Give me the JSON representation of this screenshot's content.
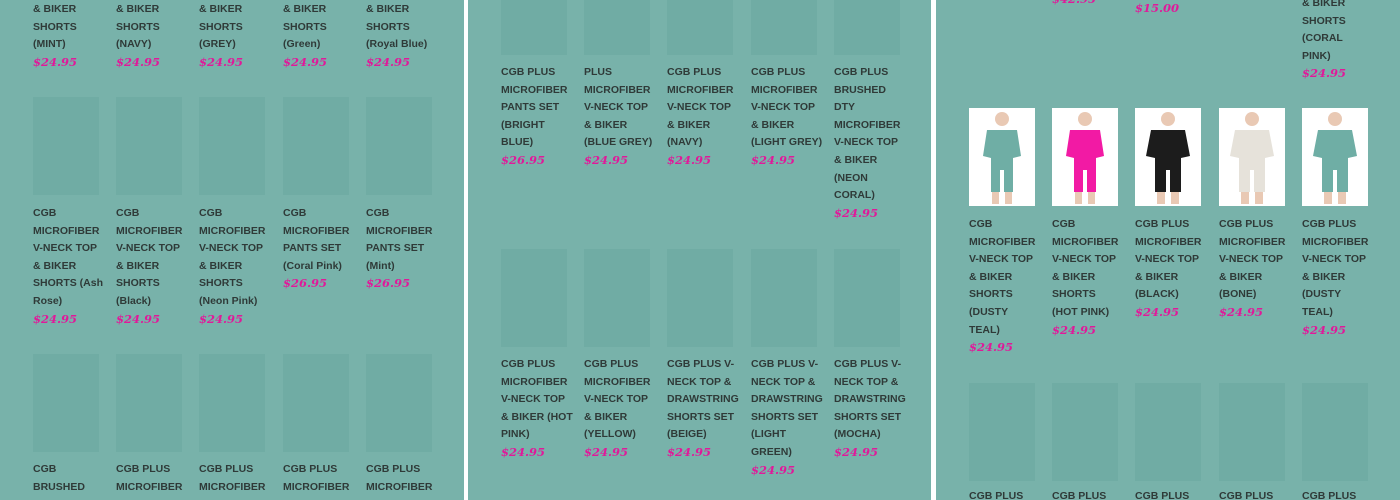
{
  "colors": {
    "background": "#78b2aa",
    "price": "#e0199a",
    "text": "#2f3a38",
    "placeholder": "#70aca4"
  },
  "panels": [
    {
      "rows": [
        [
          {
            "name": "& BIKER SHORTS (MINT)",
            "price": "$24.95"
          },
          {
            "name": "& BIKER SHORTS (NAVY)",
            "price": "$24.95"
          },
          {
            "name": "& BIKER SHORTS (GREY)",
            "price": "$24.95"
          },
          {
            "name": "& BIKER SHORTS (Green)",
            "price": "$24.95"
          },
          {
            "name": "& BIKER SHORTS (Royal Blue)",
            "price": "$24.95"
          }
        ],
        [
          {
            "name": "CGB MICROFIBER V-NECK TOP & BIKER SHORTS (Ash Rose)",
            "price": "$24.95"
          },
          {
            "name": "CGB MICROFIBER V-NECK TOP & BIKER SHORTS (Black)",
            "price": "$24.95"
          },
          {
            "name": "CGB MICROFIBER V-NECK TOP & BIKER SHORTS (Neon Pink)",
            "price": "$24.95"
          },
          {
            "name": "CGB MICROFIBER PANTS SET (Coral Pink)",
            "price": "$26.95"
          },
          {
            "name": "CGB MICROFIBER PANTS SET (Mint)",
            "price": "$26.95"
          }
        ],
        [
          {
            "name": "CGB BRUSHED",
            "price": ""
          },
          {
            "name": "CGB PLUS MICROFIBER",
            "price": ""
          },
          {
            "name": "CGB PLUS MICROFIBER",
            "price": ""
          },
          {
            "name": "CGB PLUS MICROFIBER",
            "price": ""
          },
          {
            "name": "CGB PLUS MICROFIBER",
            "price": ""
          }
        ]
      ]
    },
    {
      "rows": [
        [
          {
            "name": "CGB PLUS MICROFIBER PANTS SET (BRIGHT BLUE)",
            "price": "$26.95"
          },
          {
            "name": "PLUS MICROFIBER V-NECK TOP & BIKER (BLUE GREY)",
            "price": "$24.95"
          },
          {
            "name": "CGB PLUS MICROFIBER V-NECK TOP & BIKER (NAVY)",
            "price": "$24.95"
          },
          {
            "name": "CGB PLUS MICROFIBER V-NECK TOP & BIKER (LIGHT GREY)",
            "price": "$24.95"
          },
          {
            "name": "CGB PLUS BRUSHED DTY MICROFIBER V-NECK TOP & BIKER (NEON CORAL)",
            "price": "$24.95"
          }
        ],
        [
          {
            "name": "CGB PLUS MICROFIBER V-NECK TOP & BIKER (HOT PINK)",
            "price": "$24.95"
          },
          {
            "name": "CGB PLUS MICROFIBER V-NECK TOP & BIKER (YELLOW)",
            "price": "$24.95"
          },
          {
            "name": "CGB PLUS V-NECK TOP & DRAWSTRING SHORTS SET (BEIGE)",
            "price": "$24.95"
          },
          {
            "name": "CGB PLUS V-NECK TOP & DRAWSTRING SHORTS SET (LIGHT GREEN)",
            "price": "$24.95"
          },
          {
            "name": "CGB PLUS V-NECK TOP & DRAWSTRING SHORTS SET (MOCHA)",
            "price": "$24.95"
          }
        ]
      ]
    },
    {
      "top_row": [
        {
          "name": "",
          "price": "$42.95"
        },
        {
          "name": "",
          "price": "$15.00"
        },
        {
          "name": "",
          "price": ""
        },
        {
          "name": "& BIKER SHORTS (CORAL PINK)",
          "price": "$24.95"
        }
      ],
      "rows": [
        [
          {
            "name": "CGB MICROFIBER V-NECK TOP & BIKER SHORTS (DUSTY TEAL)",
            "price": "$24.95",
            "photo_color": "#6faea5"
          },
          {
            "name": "CGB MICROFIBER V-NECK TOP & BIKER SHORTS (HOT PINK)",
            "price": "$24.95",
            "photo_color": "#f21aa4"
          },
          {
            "name": "CGB PLUS MICROFIBER V-NECK TOP & BIKER (BLACK)",
            "price": "$24.95",
            "photo_color": "#1c1c1c"
          },
          {
            "name": "CGB PLUS MICROFIBER V-NECK TOP & BIKER (BONE)",
            "price": "$24.95",
            "photo_color": "#e6e2da"
          },
          {
            "name": "CGB PLUS MICROFIBER V-NECK TOP & BIKER (DUSTY TEAL)",
            "price": "$24.95",
            "photo_color": "#6faea5"
          }
        ],
        [
          {
            "name": "CGB PLUS",
            "price": ""
          },
          {
            "name": "CGB PLUS",
            "price": ""
          },
          {
            "name": "CGB PLUS",
            "price": ""
          },
          {
            "name": "CGB PLUS",
            "price": ""
          },
          {
            "name": "CGB PLUS",
            "price": ""
          }
        ]
      ]
    }
  ]
}
